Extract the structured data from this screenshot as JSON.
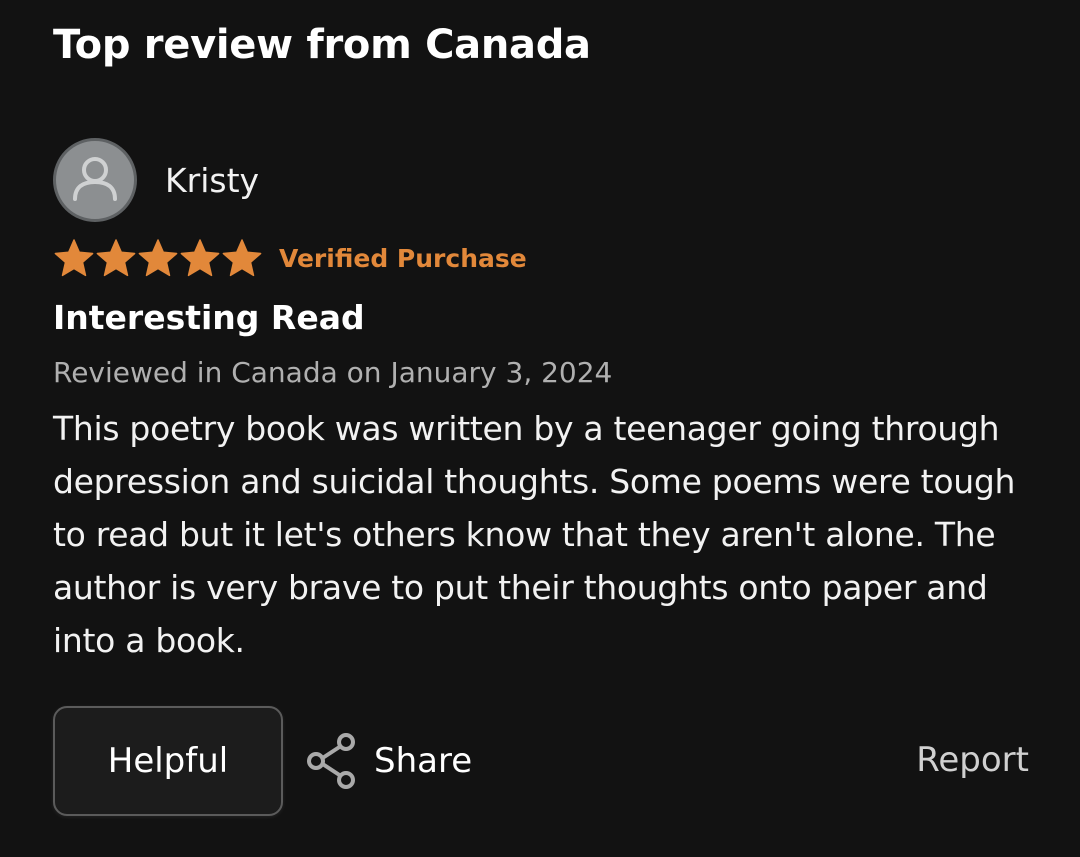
{
  "section": {
    "title": "Top review from Canada"
  },
  "review": {
    "reviewer_name": "Kristy",
    "avatar_icon": "user-silhouette-icon",
    "rating": 5,
    "rating_max": 5,
    "star_color": "#e2883a",
    "verified_label": "Verified Purchase",
    "title": "Interesting Read",
    "date_line": "Reviewed in Canada on January 3, 2024",
    "body": "This poetry book was written by a teenager going through depression and suicidal thoughts. Some poems were tough to read but it let's others know that they aren't alone. The author is very brave to put their thoughts onto paper and into a book."
  },
  "actions": {
    "helpful_label": "Helpful",
    "share_label": "Share",
    "share_icon": "share-icon",
    "report_label": "Report"
  }
}
